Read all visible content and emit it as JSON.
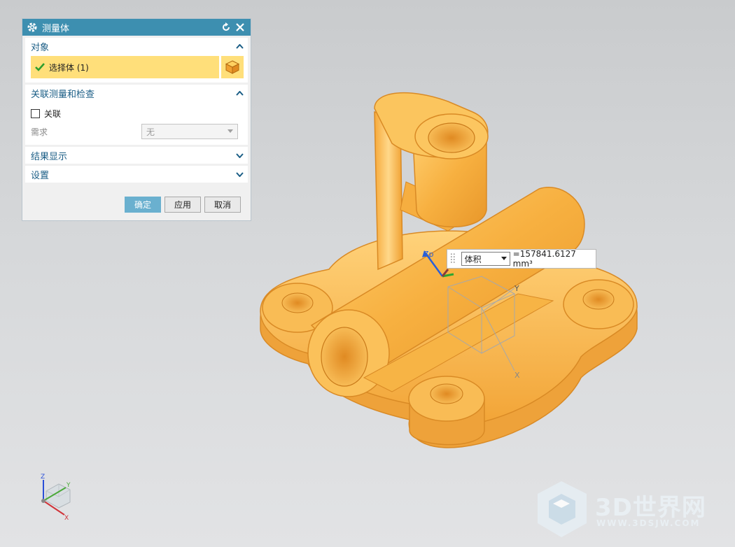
{
  "dialog": {
    "title": "测量体",
    "sections": {
      "object": {
        "header": "对象",
        "select_label": "选择体 (1)"
      },
      "assoc": {
        "header": "关联测量和检查",
        "checkbox_label": "关联",
        "req_label": "需求",
        "req_value": "无"
      },
      "result": {
        "header": "结果显示"
      },
      "settings": {
        "header": "设置"
      }
    },
    "buttons": {
      "ok": "确定",
      "apply": "应用",
      "cancel": "取消"
    }
  },
  "measurement": {
    "type": "体积",
    "value": "=157841.6127 mm³"
  },
  "axes": {
    "zp": "Zp",
    "y": "Y",
    "x": "X",
    "z": "Z"
  },
  "triad": {
    "z": "Z",
    "y": "Y",
    "x": "X"
  },
  "watermark": {
    "title": "3D世界网",
    "subtitle": "WWW.3DSJW.COM"
  },
  "colors": {
    "titlebar": "#3d8fb0",
    "section_header": "#1b5e86",
    "selection": "#ffdf7a",
    "model": "#f5b040",
    "model_edge": "#e08a20"
  },
  "icons": [
    "gear-icon",
    "reset-icon",
    "close-icon",
    "checkmark-icon",
    "cube-select-icon",
    "chevron-up-icon",
    "chevron-down-icon",
    "dropdown-arrow-icon"
  ]
}
